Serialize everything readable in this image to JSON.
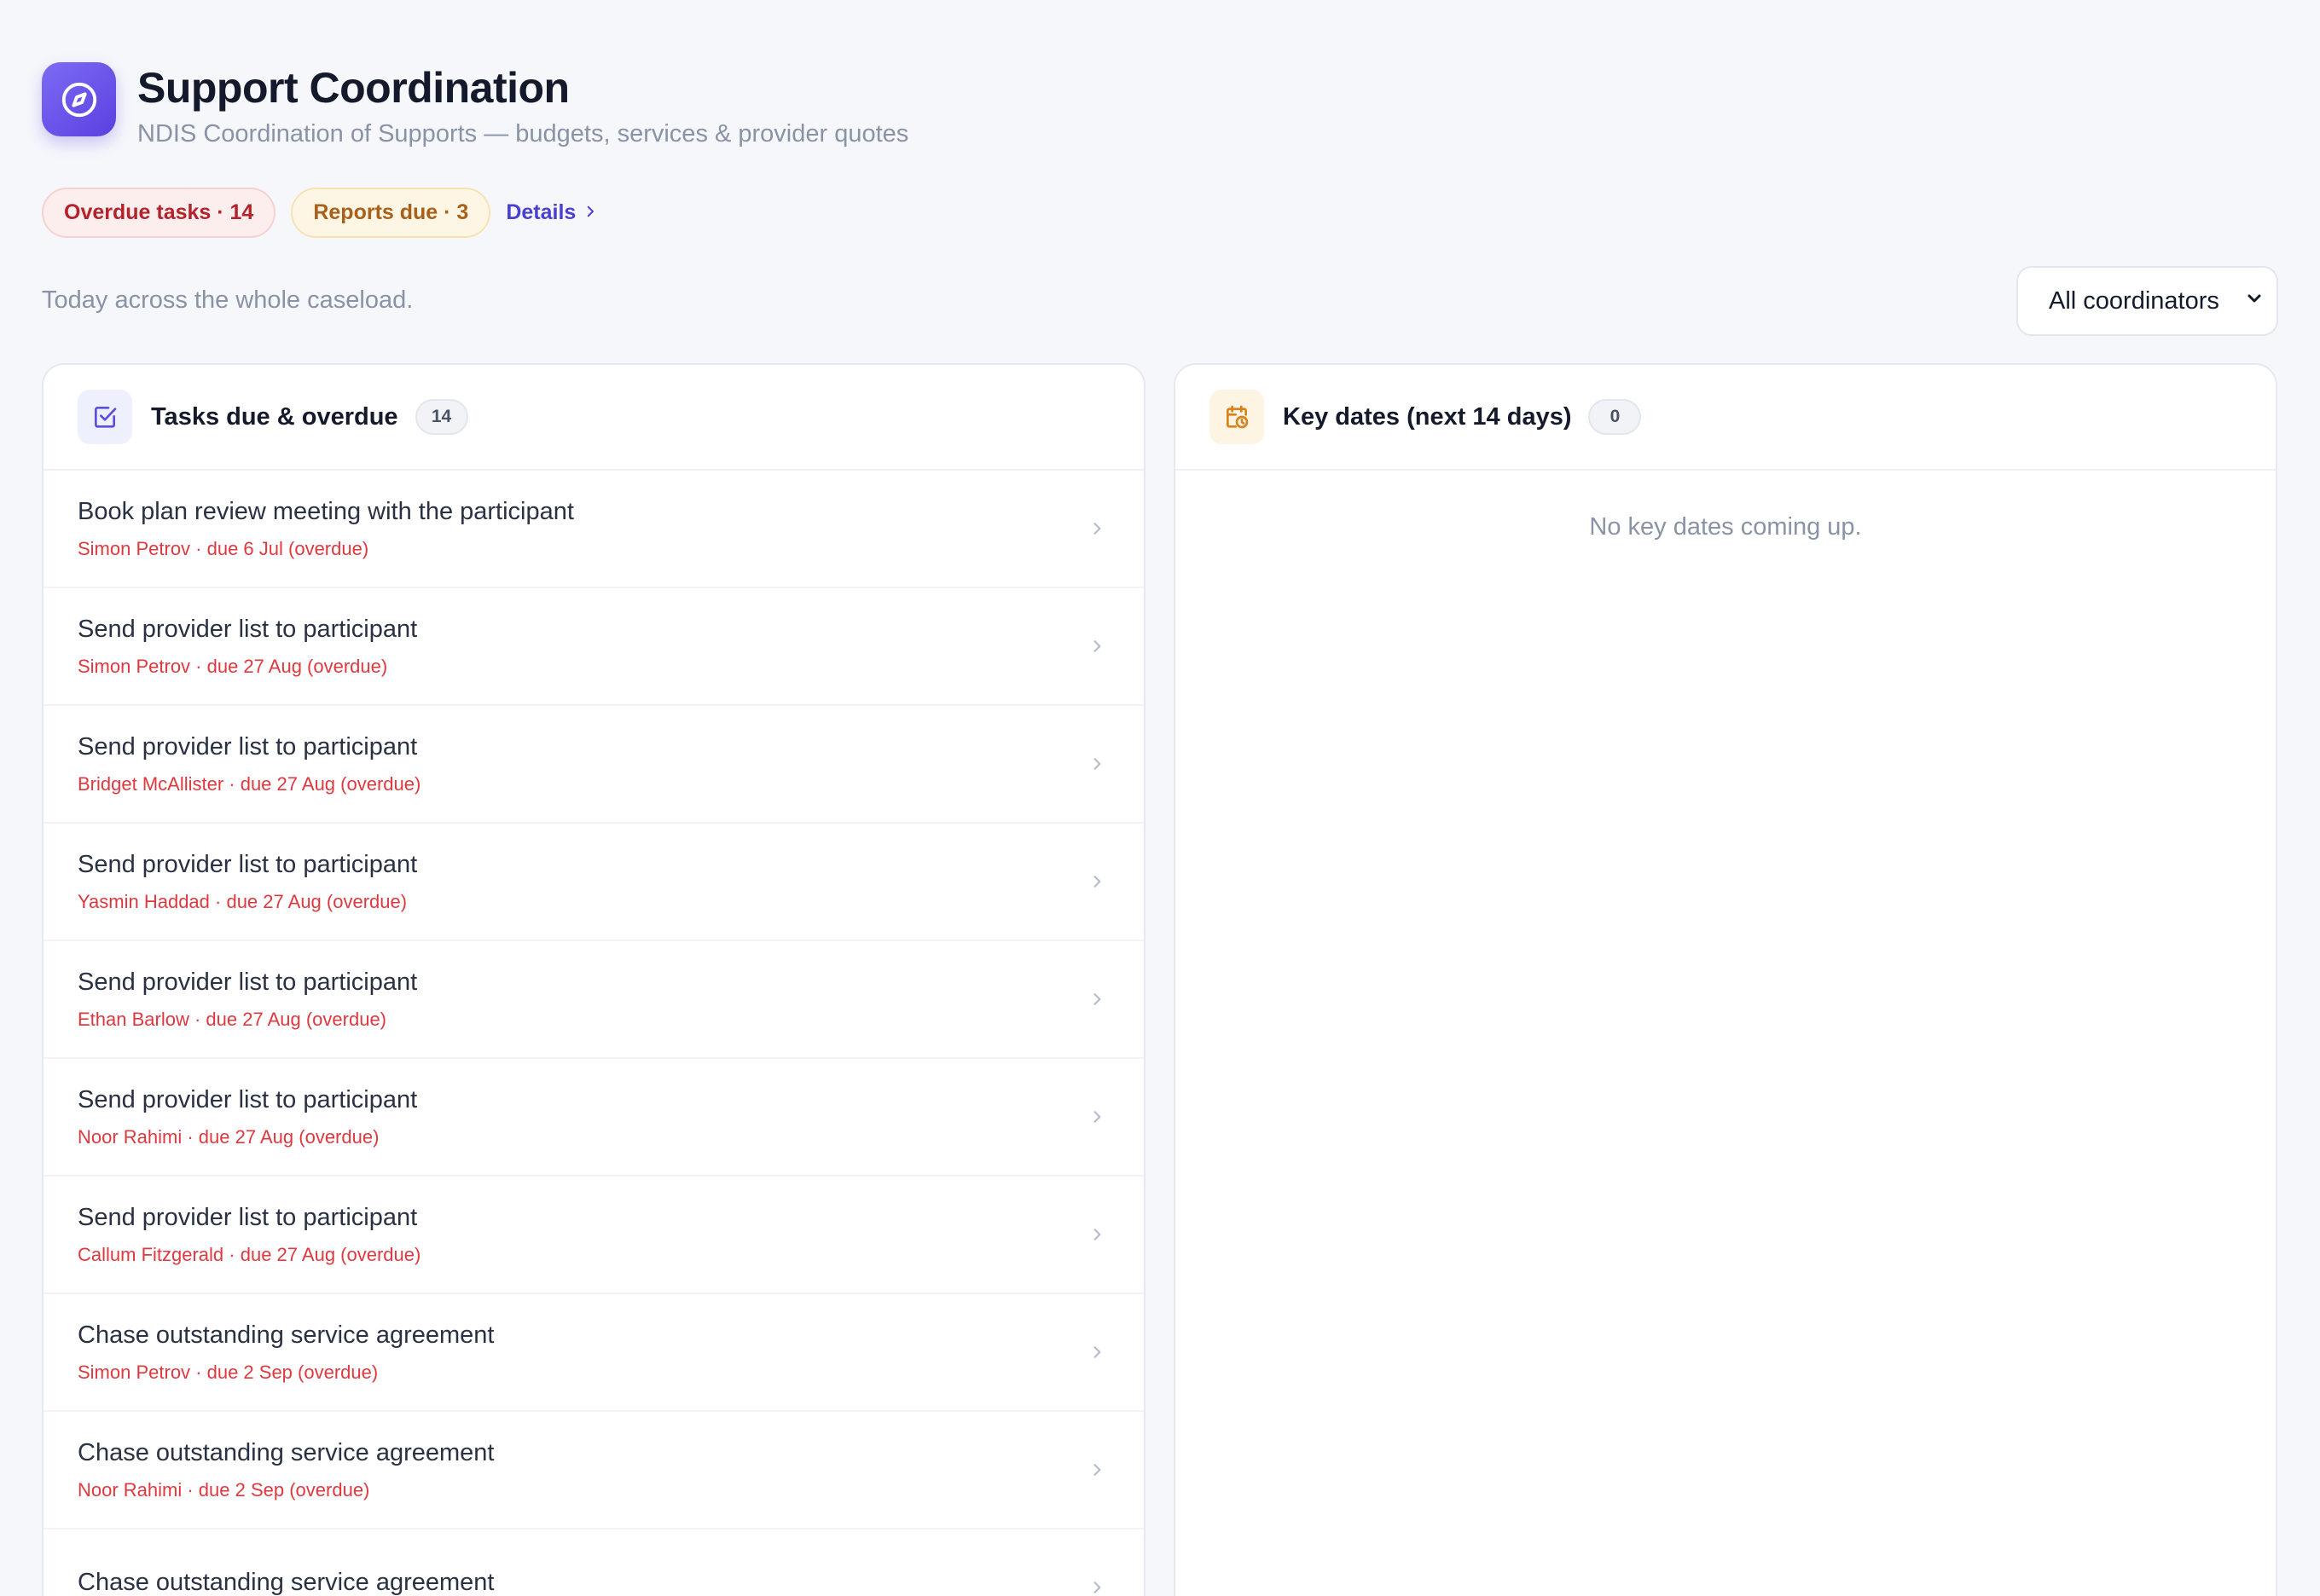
{
  "header": {
    "title": "Support Coordination",
    "subtitle": "NDIS Coordination of Supports — budgets, services & provider quotes",
    "icon": "compass-icon",
    "accent": "#5b3fe0"
  },
  "alerts": {
    "overdue_label": "Overdue tasks · 14",
    "reports_label": "Reports due · 3",
    "details_label": "Details"
  },
  "caption": "Today across the whole caseload.",
  "coordinator_filter": {
    "selected": "All coordinators"
  },
  "tasks_card": {
    "title": "Tasks due & overdue",
    "count": "14",
    "items": [
      {
        "title": "Book plan review meeting with the participant",
        "meta": "Simon Petrov · due 6 Jul (overdue)"
      },
      {
        "title": "Send provider list to participant",
        "meta": "Simon Petrov · due 27 Aug (overdue)"
      },
      {
        "title": "Send provider list to participant",
        "meta": "Bridget McAllister · due 27 Aug (overdue)"
      },
      {
        "title": "Send provider list to participant",
        "meta": "Yasmin Haddad · due 27 Aug (overdue)"
      },
      {
        "title": "Send provider list to participant",
        "meta": "Ethan Barlow · due 27 Aug (overdue)"
      },
      {
        "title": "Send provider list to participant",
        "meta": "Noor Rahimi · due 27 Aug (overdue)"
      },
      {
        "title": "Send provider list to participant",
        "meta": "Callum Fitzgerald · due 27 Aug (overdue)"
      },
      {
        "title": "Chase outstanding service agreement",
        "meta": "Simon Petrov · due 2 Sep (overdue)"
      },
      {
        "title": "Chase outstanding service agreement",
        "meta": "Noor Rahimi · due 2 Sep (overdue)"
      },
      {
        "title": "Chase outstanding service agreement",
        "meta": ""
      }
    ]
  },
  "dates_card": {
    "title": "Key dates (next 14 days)",
    "count": "0",
    "empty_text": "No key dates coming up."
  }
}
